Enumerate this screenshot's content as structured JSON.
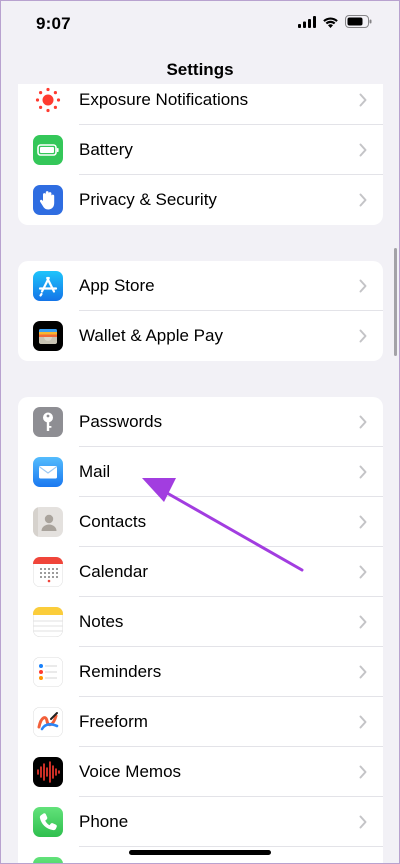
{
  "status_bar": {
    "time": "9:07"
  },
  "nav": {
    "title": "Settings"
  },
  "groups": [
    {
      "items": [
        {
          "label": "Exposure Notifications",
          "icon": "exposure-notifications-icon"
        },
        {
          "label": "Battery",
          "icon": "battery-icon"
        },
        {
          "label": "Privacy & Security",
          "icon": "privacy-hand-icon"
        }
      ]
    },
    {
      "items": [
        {
          "label": "App Store",
          "icon": "app-store-icon"
        },
        {
          "label": "Wallet & Apple Pay",
          "icon": "wallet-icon"
        }
      ]
    },
    {
      "items": [
        {
          "label": "Passwords",
          "icon": "key-icon"
        },
        {
          "label": "Mail",
          "icon": "mail-icon"
        },
        {
          "label": "Contacts",
          "icon": "contacts-icon"
        },
        {
          "label": "Calendar",
          "icon": "calendar-icon"
        },
        {
          "label": "Notes",
          "icon": "notes-icon"
        },
        {
          "label": "Reminders",
          "icon": "reminders-icon"
        },
        {
          "label": "Freeform",
          "icon": "freeform-icon"
        },
        {
          "label": "Voice Memos",
          "icon": "voice-memos-icon"
        },
        {
          "label": "Phone",
          "icon": "phone-icon"
        },
        {
          "label": "",
          "icon": "messages-icon"
        }
      ]
    }
  ],
  "annotation": {
    "target": "Mail",
    "color": "#a23de0"
  },
  "colors": {
    "background": "#f2f1f6",
    "chevron": "#c4c4c7",
    "separator": "#e3e3e8"
  }
}
